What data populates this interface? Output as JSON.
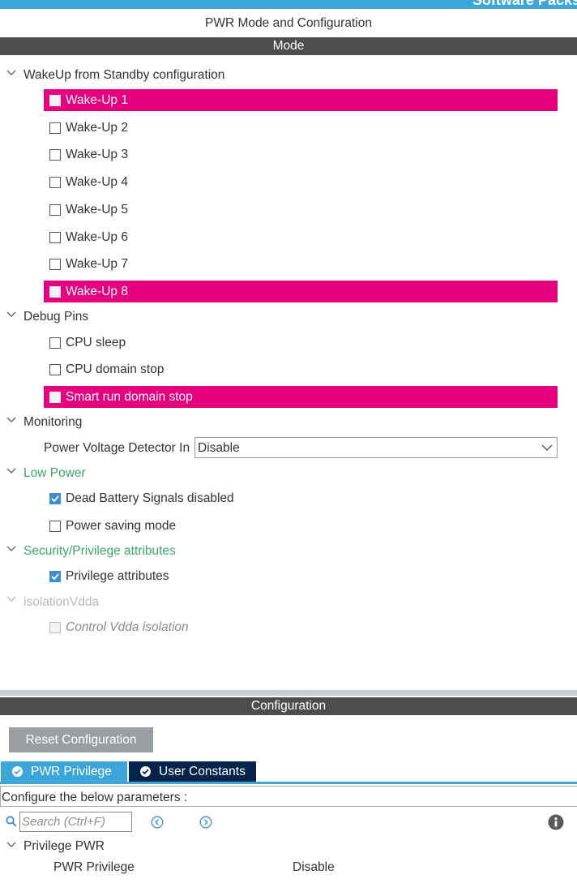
{
  "header": {
    "strip_text": "Software Packs",
    "title": "PWR Mode and Configuration",
    "mode_label": "Mode",
    "config_label": "Configuration"
  },
  "colors": {
    "accent_blue": "#3aa6d9",
    "highlight_pink": "#e6007e",
    "section_green": "#3ca66b",
    "dark_bar": "#4d4d4d",
    "navy_tab": "#03234b"
  },
  "mode": {
    "wakeup": {
      "title": "WakeUp from Standby configuration",
      "items": [
        {
          "label": "Wake-Up 1",
          "checked": false,
          "highlighted": true
        },
        {
          "label": "Wake-Up 2",
          "checked": false,
          "highlighted": false
        },
        {
          "label": "Wake-Up 3",
          "checked": false,
          "highlighted": false
        },
        {
          "label": "Wake-Up 4",
          "checked": false,
          "highlighted": false
        },
        {
          "label": "Wake-Up 5",
          "checked": false,
          "highlighted": false
        },
        {
          "label": "Wake-Up 6",
          "checked": false,
          "highlighted": false
        },
        {
          "label": "Wake-Up 7",
          "checked": false,
          "highlighted": false
        },
        {
          "label": "Wake-Up 8",
          "checked": false,
          "highlighted": true
        }
      ]
    },
    "debug": {
      "title": "Debug Pins",
      "items": [
        {
          "label": "CPU sleep",
          "checked": false,
          "highlighted": false
        },
        {
          "label": "CPU domain stop",
          "checked": false,
          "highlighted": false
        },
        {
          "label": "Smart run domain stop",
          "checked": false,
          "highlighted": true
        }
      ]
    },
    "monitoring": {
      "title": "Monitoring",
      "pvd_label": "Power Voltage Detector In",
      "pvd_value": "Disable"
    },
    "low_power": {
      "title": "Low Power",
      "items": [
        {
          "label": "Dead Battery Signals disabled",
          "checked": true
        },
        {
          "label": "Power saving mode",
          "checked": false
        }
      ]
    },
    "security": {
      "title": "Security/Privilege attributes",
      "items": [
        {
          "label": "Privilege attributes",
          "checked": true
        }
      ]
    },
    "isolation": {
      "title": "isolationVdda",
      "items": [
        {
          "label": "Control Vdda isolation",
          "checked": false,
          "disabled": true
        }
      ]
    }
  },
  "configuration": {
    "reset_label": "Reset Configuration",
    "tabs": [
      {
        "label": "PWR Privilege",
        "active": true
      },
      {
        "label": "User Constants",
        "active": false
      }
    ],
    "instruction": "Configure the below parameters :",
    "search_placeholder": "Search (Ctrl+F)",
    "group_title": "Privilege PWR",
    "params": [
      {
        "name": "PWR Privilege",
        "value": "Disable"
      }
    ]
  }
}
